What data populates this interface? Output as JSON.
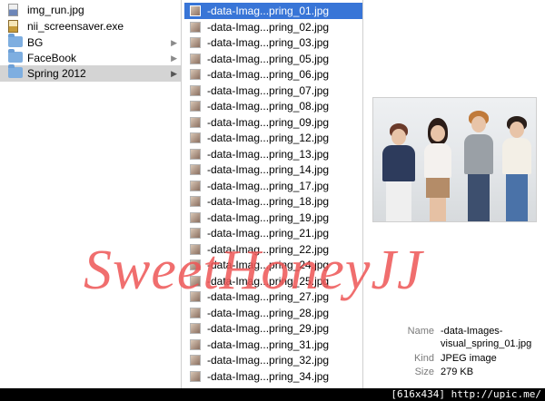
{
  "column1": {
    "items": [
      {
        "label": "img_run.jpg",
        "icon": "image-file-icon",
        "kind": "file"
      },
      {
        "label": "nii_screensaver.exe",
        "icon": "exe-file-icon",
        "kind": "file"
      },
      {
        "label": "BG",
        "icon": "folder-icon",
        "kind": "folder"
      },
      {
        "label": "FaceBook",
        "icon": "folder-icon",
        "kind": "folder"
      },
      {
        "label": "Spring 2012",
        "icon": "folder-icon",
        "kind": "folder",
        "selected": true
      }
    ]
  },
  "column2": {
    "items": [
      "-data-Imag...pring_01.jpg",
      "-data-Imag...pring_02.jpg",
      "-data-Imag...pring_03.jpg",
      "-data-Imag...pring_05.jpg",
      "-data-Imag...pring_06.jpg",
      "-data-Imag...pring_07.jpg",
      "-data-Imag...pring_08.jpg",
      "-data-Imag...pring_09.jpg",
      "-data-Imag...pring_12.jpg",
      "-data-Imag...pring_13.jpg",
      "-data-Imag...pring_14.jpg",
      "-data-Imag...pring_17.jpg",
      "-data-Imag...pring_18.jpg",
      "-data-Imag...pring_19.jpg",
      "-data-Imag...pring_21.jpg",
      "-data-Imag...pring_22.jpg",
      "-data-Imag...pring_24.jpg",
      "-data-Imag...pring_25.jpg",
      "-data-Imag...pring_27.jpg",
      "-data-Imag...pring_28.jpg",
      "-data-Imag...pring_29.jpg",
      "-data-Imag...pring_31.jpg",
      "-data-Imag...pring_32.jpg",
      "-data-Imag...pring_34.jpg"
    ],
    "selected_index": 0
  },
  "preview": {
    "name_key": "Name",
    "name_value_line1": "-data-Images-",
    "name_value_line2": "visual_spring_01.jpg",
    "kind_key": "Kind",
    "kind_value": "JPEG image",
    "size_key": "Size",
    "size_value": "279 KB"
  },
  "watermark": "SweetHoneyJJ",
  "footer": "[616x434] http://upic.me/",
  "colors": {
    "selection": "#3875d7",
    "watermark": "#ee5656"
  }
}
